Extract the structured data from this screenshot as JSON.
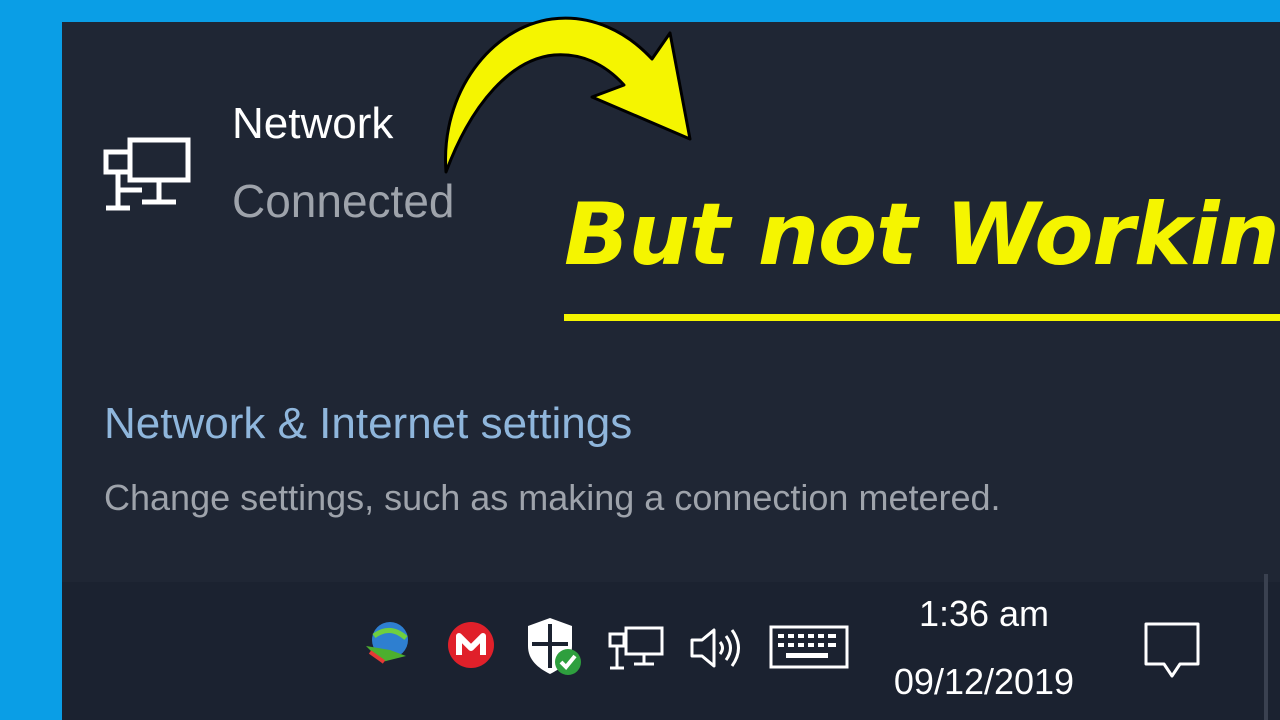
{
  "network": {
    "name": "Network",
    "status": "Connected",
    "icon": "wired-network-icon"
  },
  "overlay": {
    "text": "But not Working",
    "color": "#f5f500"
  },
  "settings": {
    "link": "Network & Internet settings",
    "description": "Change settings, such as making a connection metered."
  },
  "taskbar": {
    "time": "1:36 am",
    "date": "09/12/2019",
    "tray_icons": [
      "download-manager-icon",
      "mega-icon",
      "windows-security-icon",
      "network-icon",
      "volume-icon",
      "keyboard-icon"
    ],
    "notification_icon": "action-center-icon"
  },
  "colors": {
    "background": "#0a9ee6",
    "panel": "#1f2634",
    "link": "#8fb6dc",
    "muted_text": "#9ea3ab"
  }
}
